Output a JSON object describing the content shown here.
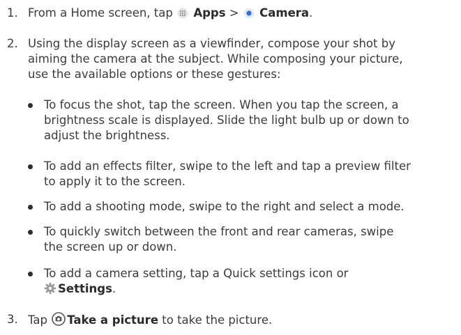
{
  "steps": [
    {
      "number": "1.",
      "t1": "From a Home screen, tap ",
      "apps": "Apps",
      "sep": " > ",
      "camera": "Camera",
      "end": "."
    },
    {
      "number": "2.",
      "lines": [
        "Using the display screen as a viewfinder, compose your shot by",
        "aiming the camera at the subject. While composing your picture,",
        "use the available options or these gestures:"
      ]
    },
    {
      "number": "3.",
      "t1": "Tap ",
      "take": "Take a picture",
      "t2": " to take the picture."
    }
  ],
  "bullets": [
    {
      "lines": [
        "To focus the shot, tap the screen. When you tap the screen, a",
        "brightness scale is displayed. Slide the light bulb up or down to",
        "adjust the brightness."
      ]
    },
    {
      "lines": [
        "To add an effects filter, swipe to the left and tap a preview filter",
        "to apply it to the screen."
      ]
    },
    {
      "lines": [
        "To add a shooting mode, swipe to the right and select a mode."
      ]
    },
    {
      "lines": [
        "To quickly switch between the front and rear cameras, swipe",
        "the screen up or down."
      ]
    },
    {
      "line1": "To add a camera setting, tap a Quick settings icon or",
      "settings": "Settings",
      "end": "."
    }
  ],
  "icons": {
    "apps": "apps-grid-icon",
    "camera": "camera-app-icon",
    "settings": "gear-icon",
    "shutter": "shutter-icon"
  },
  "colors": {
    "text": "#3b3b3b",
    "camera_blue": "#2f6fe0",
    "settings_gray": "#9a9a9a"
  }
}
